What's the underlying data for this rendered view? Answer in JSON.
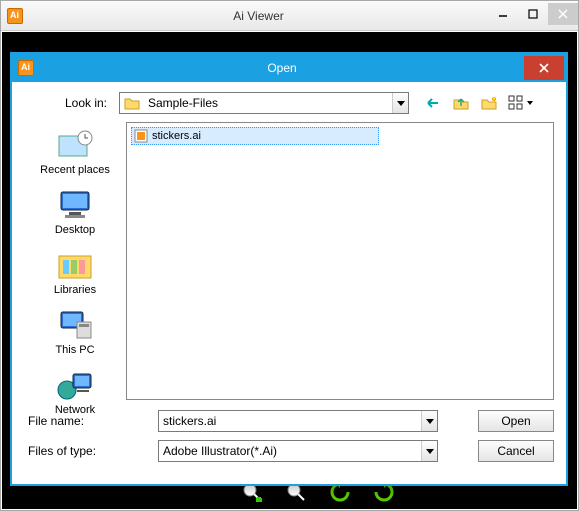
{
  "main": {
    "title": "Ai Viewer"
  },
  "dialog": {
    "title": "Open",
    "look_in_label": "Look in:",
    "look_in_value": "Sample-Files",
    "places": [
      {
        "label": "Recent places"
      },
      {
        "label": "Desktop"
      },
      {
        "label": "Libraries"
      },
      {
        "label": "This PC"
      },
      {
        "label": "Network"
      }
    ],
    "files": [
      {
        "name": "stickers.ai"
      }
    ],
    "filename_label": "File name:",
    "filename_value": "stickers.ai",
    "filetype_label": "Files of type:",
    "filetype_value": "Adobe Illustrator(*.Ai)",
    "open_button": "Open",
    "cancel_button": "Cancel"
  }
}
